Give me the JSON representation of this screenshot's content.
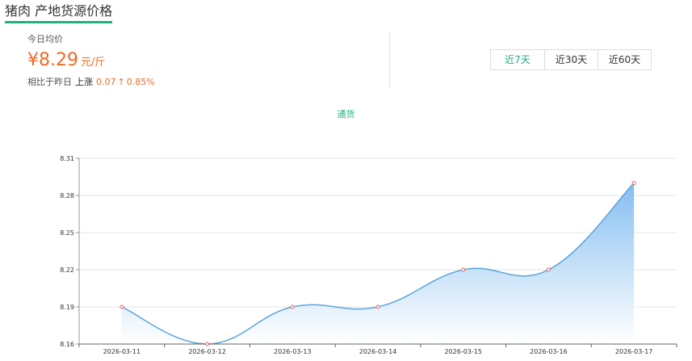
{
  "header": {
    "title": "猪肉 产地货源价格"
  },
  "summary": {
    "today_label": "今日均价",
    "price": "¥8.29",
    "unit": "元/斤",
    "compare_label": "相比于昨日",
    "trend_word": "上涨",
    "change_abs": "0.07",
    "arrow": "↑",
    "change_pct": "0.85%"
  },
  "range_tabs": [
    {
      "label": "近7天",
      "active": true
    },
    {
      "label": "近30天",
      "active": false
    },
    {
      "label": "近60天",
      "active": false
    }
  ],
  "colors": {
    "accent": "#1fae84",
    "price": "#ef6a25",
    "line": "#5aa5dc",
    "area_top": "#6eb2ee",
    "marker": "#e2655e"
  },
  "chart_data": {
    "type": "area",
    "x": [
      "2026-03-11",
      "2026-03-12",
      "2026-03-13",
      "2026-03-14",
      "2026-03-15",
      "2026-03-16",
      "2026-03-17"
    ],
    "series": [
      {
        "name": "通货",
        "values": [
          8.19,
          8.16,
          8.19,
          8.19,
          8.22,
          8.22,
          8.29
        ]
      }
    ],
    "yticks": [
      "8.16",
      "8.19",
      "8.22",
      "8.25",
      "8.28",
      "8.31"
    ],
    "ylim": [
      8.16,
      8.31
    ],
    "grid": true,
    "legend_position": "top-center",
    "smooth": true
  }
}
